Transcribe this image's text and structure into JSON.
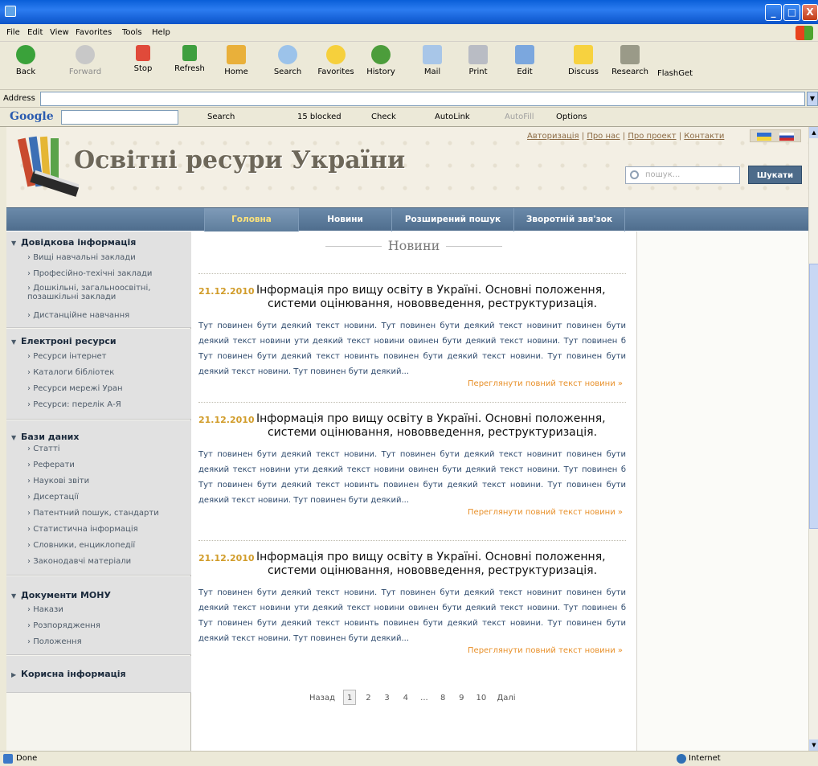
{
  "window": {
    "minimize": "_",
    "maximize": "□",
    "close": "X"
  },
  "menu": [
    "File",
    "Edit",
    "View",
    "Favorites",
    "Tools",
    "Help"
  ],
  "toolbar": {
    "back": "Back",
    "forward": "Forward",
    "stop": "Stop",
    "refresh": "Refresh",
    "home": "Home",
    "search": "Search",
    "favorites": "Favorites",
    "history": "History",
    "mail": "Mail",
    "print": "Print",
    "edit": "Edit",
    "discuss": "Discuss",
    "research": "Research",
    "flashget": "FlashGet"
  },
  "address": {
    "label": "Address",
    "value": ""
  },
  "googlebar": {
    "logo": "Google",
    "search": "Search",
    "blocked": "15 blocked",
    "check": "Check",
    "autolink": "AutoLink",
    "autofill": "AutoFill",
    "options": "Options"
  },
  "site": {
    "title": "Освітні ресури України",
    "toplinks": [
      "Авторизація",
      "Про нас",
      "Про проект",
      "Контакти"
    ],
    "search_placeholder": "пошук...",
    "search_button": "Шукати",
    "nav": [
      "Головна",
      "Новини",
      "Розширений пошук",
      "Зворотній звя'зок"
    ]
  },
  "sidebar": [
    {
      "title": "Довідкова інформація",
      "items": [
        "Вищі навчальні заклади",
        "Професійно-техічні заклади",
        "Дошкільні, загальноосвітні, позашкільні заклади",
        "Дистанційне навчання"
      ]
    },
    {
      "title": "Електроні ресурси",
      "items": [
        "Ресурси інтернет",
        "Каталоги бібліотек",
        "Ресурси мережі Уран",
        "Ресурси: перелік А-Я"
      ]
    },
    {
      "title": "Бази даних",
      "items": [
        "Статті",
        "Реферати",
        "Наукові звіти",
        "Дисертації",
        "Патентний пошук, стандарти",
        "Статистична інформація",
        "Словники, енциклопедії",
        "Законодавчі матеріали"
      ]
    },
    {
      "title": "Документи МОНУ",
      "items": [
        "Накази",
        "Розпорядження",
        "Положення"
      ]
    },
    {
      "title": "Корисна інформація",
      "items": []
    }
  ],
  "news_heading": "Новини",
  "news": [
    {
      "date": "21.12.2010",
      "title_l1": "Інформація про вищу освіту в Україні. Основні положення,",
      "title_l2": "системи оцінювання,  нововведення, реструктуризація.",
      "body": "Тут повинен бути деякий текст новини. Тут повинен бути деякий текст новинит повинен бути деякий текст новини ути деякий текст новини овинен бути деякий текст новини. Тут повинен б Тут повинен бути деякий текст новинть  повинен бути деякий текст новини. Тут повинен бути деякий текст новини. Тут повинен бути деякий...",
      "more": "Переглянути повний текст новини »"
    },
    {
      "date": "21.12.2010",
      "title_l1": "Інформація про вищу освіту в Україні. Основні положення,",
      "title_l2": "системи оцінювання,  нововведення, реструктуризація.",
      "body": "Тут повинен бути деякий текст новини. Тут повинен бути деякий текст новинит повинен бути деякий текст новини ути деякий текст новини овинен бути деякий текст новини. Тут повинен б Тут повинен бути деякий текст новинть  повинен бути деякий текст новини. Тут повинен бути деякий текст новини. Тут повинен бути деякий...",
      "more": "Переглянути повний текст новини »"
    },
    {
      "date": "21.12.2010",
      "title_l1": "Інформація про вищу освіту в Україні. Основні положення,",
      "title_l2": "системи оцінювання,  нововведення, реструктуризація.",
      "body": "Тут повинен бути деякий текст новини. Тут повинен бути деякий текст новинит повинен бути деякий текст новини ути деякий текст новини овинен бути деякий текст новини. Тут повинен б Тут повинен бути деякий текст новинть  повинен бути деякий текст новини. Тут повинен бути деякий текст новини. Тут повинен бути деякий...",
      "more": "Переглянути повний текст новини »"
    }
  ],
  "pager": {
    "prev": "Назад",
    "pages": [
      "1",
      "2",
      "3",
      "4",
      "...",
      "8",
      "9",
      "10"
    ],
    "current": "1",
    "next": "Далі"
  },
  "status": {
    "text": "Done",
    "zone": "Internet"
  },
  "colors": {
    "nav": "#5a7898",
    "date": "#d19c2a",
    "more": "#e8902a",
    "body": "#2e4a6d"
  }
}
